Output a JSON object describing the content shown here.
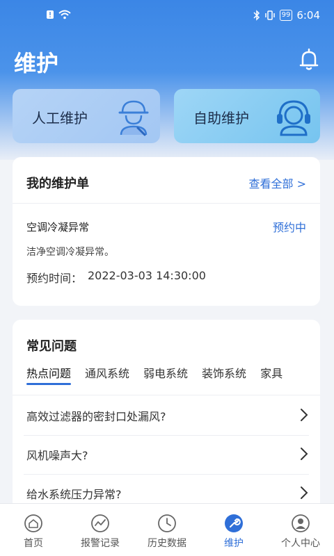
{
  "status_bar": {
    "time": "6:04",
    "battery": "99"
  },
  "header": {
    "title": "维护"
  },
  "service_cards": [
    {
      "label": "人工维护",
      "icon": "worker-icon"
    },
    {
      "label": "自助维护",
      "icon": "headset-icon"
    }
  ],
  "orders": {
    "title": "我的维护单",
    "view_all": "查看全部 >",
    "item": {
      "name": "空调冷凝异常",
      "status": "预约中",
      "description": "洁净空调冷凝异常。",
      "time_label": "预约时间：",
      "time_value": "2022-03-03 14:30:00"
    }
  },
  "faq": {
    "title": "常见问题",
    "tabs": [
      "热点问题",
      "通风系统",
      "弱电系统",
      "装饰系统",
      "家具"
    ],
    "active_tab": 0,
    "items": [
      "高效过滤器的密封口处漏风?",
      "风机噪声大?",
      "给水系统压力异常?"
    ]
  },
  "bottom_nav": {
    "items": [
      {
        "label": "首页",
        "icon": "home-icon"
      },
      {
        "label": "报警记录",
        "icon": "alarm-chart-icon"
      },
      {
        "label": "历史数据",
        "icon": "clock-icon"
      },
      {
        "label": "维护",
        "icon": "wrench-icon"
      },
      {
        "label": "个人中心",
        "icon": "user-icon"
      }
    ],
    "active_index": 3
  },
  "colors": {
    "primary": "#2f6fd8",
    "header": "#3b86e6"
  }
}
